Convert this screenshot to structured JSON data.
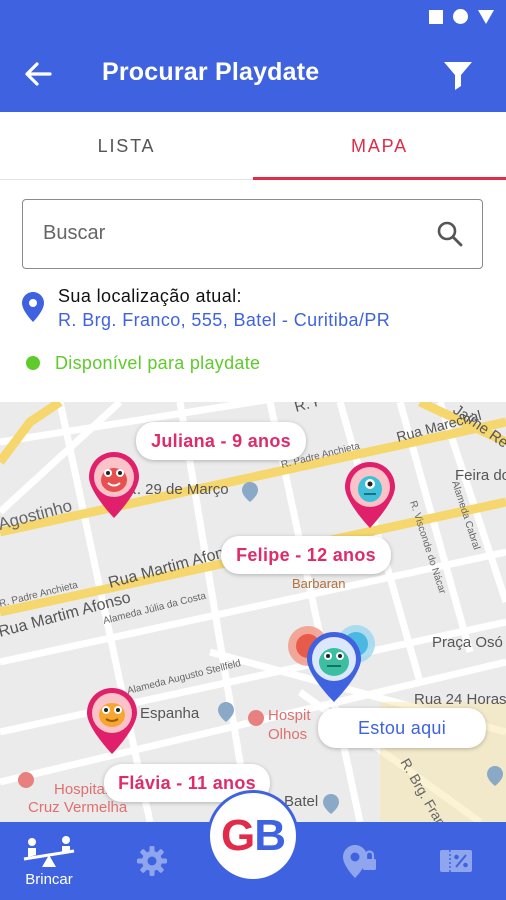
{
  "header": {
    "title": "Procurar Playdate"
  },
  "tabs": [
    {
      "label": "LISTA",
      "active": false
    },
    {
      "label": "MAPA",
      "active": true
    }
  ],
  "search": {
    "placeholder": "Buscar",
    "value": ""
  },
  "location": {
    "label": "Sua localização atual:",
    "address": "R. Brg. Franco, 555, Batel - Curitiba/PR"
  },
  "availability": {
    "text": "Disponível para playdate",
    "color": "#5fcb2b"
  },
  "map": {
    "street_labels": [
      "Agostinho",
      "Rua Martim Afonso",
      "Rua Martim Afonso",
      "R. 29 de Março",
      "R. Padre Anchieta",
      "Alameda Júlia da Costa",
      "Alameda Augusto Stellfeld",
      "R. Visconde do Nácar",
      "Alameda Cabral",
      "R. Brg. Franco",
      "Rua 24 Horas",
      "Praça Osório",
      "Feira do",
      "Espanha",
      "Hospital",
      "Olhos",
      "Batel",
      "Hospital",
      "Cruz Vermelha",
      "Barbaran",
      "Jaime Re"
    ],
    "people": [
      {
        "label": "Juliana - 9 anos",
        "avatar": "red-monster"
      },
      {
        "label": "Felipe - 12 anos",
        "avatar": "teal-monster"
      },
      {
        "label": "Flávia - 11 anos",
        "avatar": "orange-monster"
      }
    ],
    "you_are_here": "Estou aqui"
  },
  "bottom_nav": {
    "brincar_label": "Brincar",
    "logo_g": "G",
    "logo_b": "B",
    "icons": [
      "seesaw-icon",
      "gear-icon",
      "location-lock-icon",
      "discount-icon"
    ]
  },
  "colors": {
    "primary": "#3f63e0",
    "accent": "#e02b4a",
    "available": "#5fcb2b"
  }
}
